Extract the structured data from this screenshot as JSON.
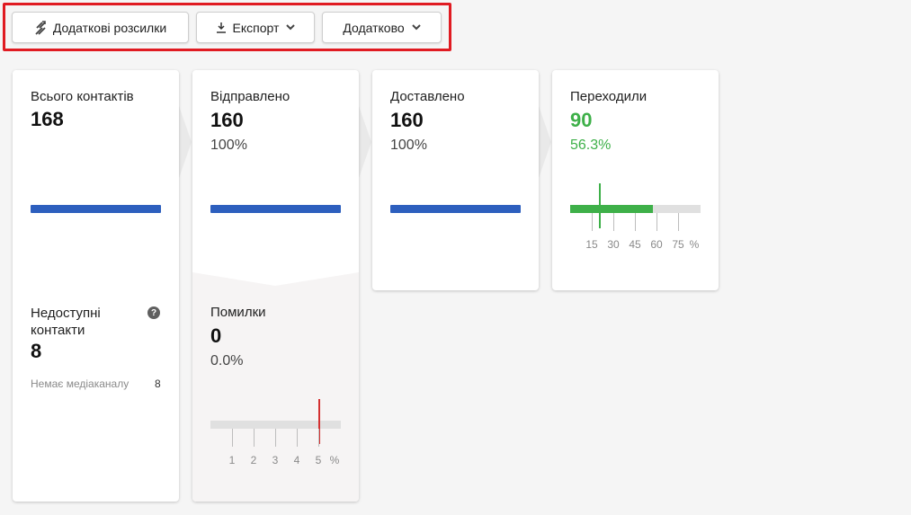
{
  "toolbar": {
    "more_mailings_label": "Додаткові розсилки",
    "export_label": "Експорт",
    "additional_label": "Додатково"
  },
  "stats": {
    "total": {
      "label": "Всього контактів",
      "value": "168"
    },
    "unavailable": {
      "label": "Недоступні контакти",
      "value": "8",
      "no_channel_label": "Немає медіаканалу",
      "no_channel_value": "8"
    },
    "sent": {
      "label": "Відправлено",
      "value": "160",
      "percent": "100%"
    },
    "errors": {
      "label": "Помилки",
      "value": "0",
      "percent": "0.0%",
      "scale_ticks": [
        "1",
        "2",
        "3",
        "4",
        "5"
      ],
      "scale_unit": "%",
      "threshold_percent": 5,
      "fill_fraction": 0.0
    },
    "delivered": {
      "label": "Доставлено",
      "value": "160",
      "percent": "100%"
    },
    "clicked": {
      "label": "Переходили",
      "value": "90",
      "percent": "56.3%",
      "scale_ticks": [
        "15",
        "30",
        "45",
        "60",
        "75"
      ],
      "scale_unit": "%",
      "fill_fraction": 0.563,
      "threshold_percent": 22
    }
  },
  "colors": {
    "highlight": "#e01b22",
    "bar_blue": "#2d5fbe",
    "success_green": "#3eb049",
    "error_red": "#d32f2f",
    "track_gray": "#e0e0e0"
  }
}
